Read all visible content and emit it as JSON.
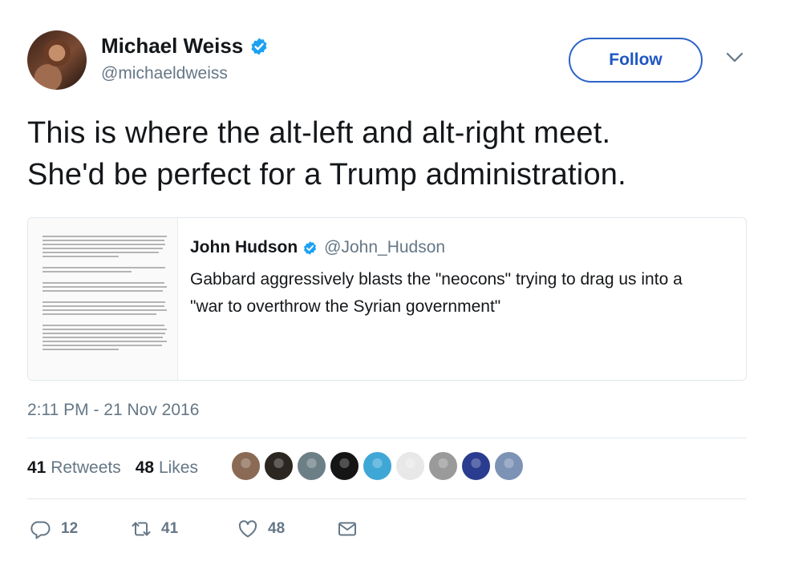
{
  "author": {
    "name": "Michael Weiss",
    "handle": "@michaeldweiss",
    "verified_icon": "verified-badge-icon"
  },
  "header": {
    "follow_label": "Follow",
    "menu_icon": "chevron-down-icon"
  },
  "tweet": {
    "line1": "This is where the alt-left and alt-right meet.",
    "line2": "She'd be perfect for a Trump administration.",
    "timestamp": "2:11 PM - 21 Nov 2016"
  },
  "quote": {
    "name": "John Hudson",
    "handle": "@John_Hudson",
    "line1": "Gabbard aggressively blasts the \"neocons\" trying to drag us into a",
    "line2": "\"war to overthrow the Syrian government\""
  },
  "stats": {
    "retweets_count": "41",
    "retweets_label": "Retweets",
    "likes_count": "48",
    "likes_label": "Likes"
  },
  "likers_colors": [
    "#8a6a55",
    "#2b2620",
    "#6d7f86",
    "#151515",
    "#3fa7d6",
    "#e8e8e8",
    "#9a9a9a",
    "#2a3c8f",
    "#7d93b5"
  ],
  "actions": {
    "reply_count": "12",
    "retweet_count": "41",
    "like_count": "48"
  },
  "colors": {
    "accent": "#1f56c2",
    "verified": "#1da1f2",
    "secondary_text": "#657786",
    "border": "#e1e8ed"
  }
}
